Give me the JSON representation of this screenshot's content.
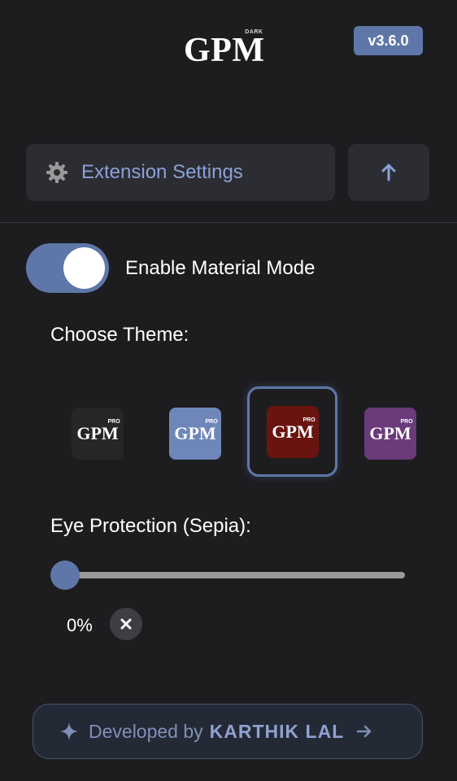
{
  "header": {
    "logo_text": "GPM",
    "logo_badge": "DARK",
    "version": "v3.6.0"
  },
  "settings": {
    "label": "Extension Settings",
    "icon": "gear-icon",
    "scroll_top_icon": "arrow-up-icon"
  },
  "material_mode": {
    "label": "Enable Material Mode",
    "enabled": true
  },
  "theme": {
    "label": "Choose Theme:",
    "selected_index": 2,
    "options": [
      {
        "logo": "GPM",
        "badge": "PRO",
        "color": "#262626"
      },
      {
        "logo": "GPM",
        "badge": "PRO",
        "color": "#6f87b8"
      },
      {
        "logo": "GPM",
        "badge": "PRO",
        "color": "#6a1410"
      },
      {
        "logo": "GPM",
        "badge": "PRO",
        "color": "#6a3a7a"
      }
    ]
  },
  "sepia": {
    "label": "Eye Protection (Sepia):",
    "value_text": "0%",
    "value": 0
  },
  "footer": {
    "prefix": "Developed by",
    "name": "KARTHIK LAL"
  },
  "colors": {
    "background": "#1d1d20",
    "accent": "#5f77a8",
    "panel": "#2b2d33",
    "accent_text": "#8aa0d6"
  }
}
